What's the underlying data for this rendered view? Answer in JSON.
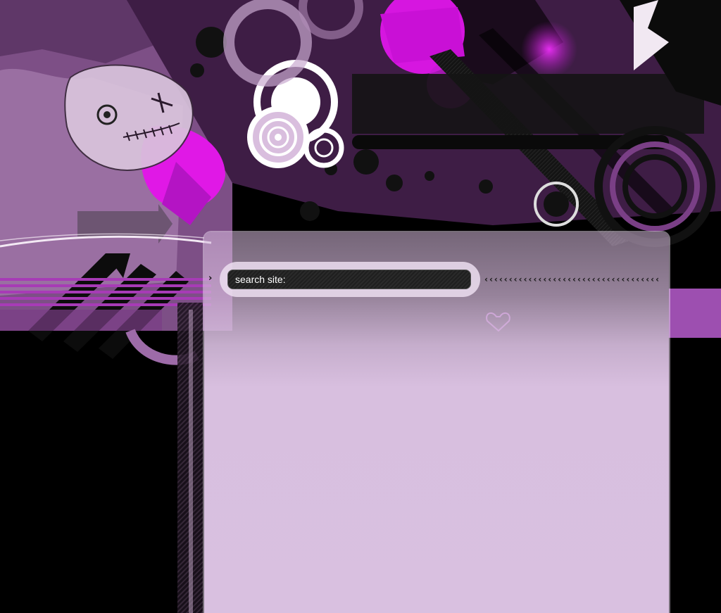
{
  "search": {
    "label": "search site:",
    "arrow_glyph": "›",
    "chevrons": "‹‹‹‹‹‹‹‹‹‹‹‹‹‹‹‹‹‹‹‹‹‹‹‹‹‹‹‹‹‹‹‹‹‹‹‹"
  },
  "theme": {
    "background": "#000000",
    "accent_magenta": "#d616e0",
    "accent_purple": "#8e3fa0",
    "panel_lavender": "#d9c0e0",
    "light_lavender": "#e6d0ea"
  },
  "icons": {
    "logo": "concentric-circles-logo",
    "doll": "stitched-voodoo-doll-illustration",
    "heart": "heart-icon",
    "arrows": "diagonal-arrows-graphic"
  }
}
